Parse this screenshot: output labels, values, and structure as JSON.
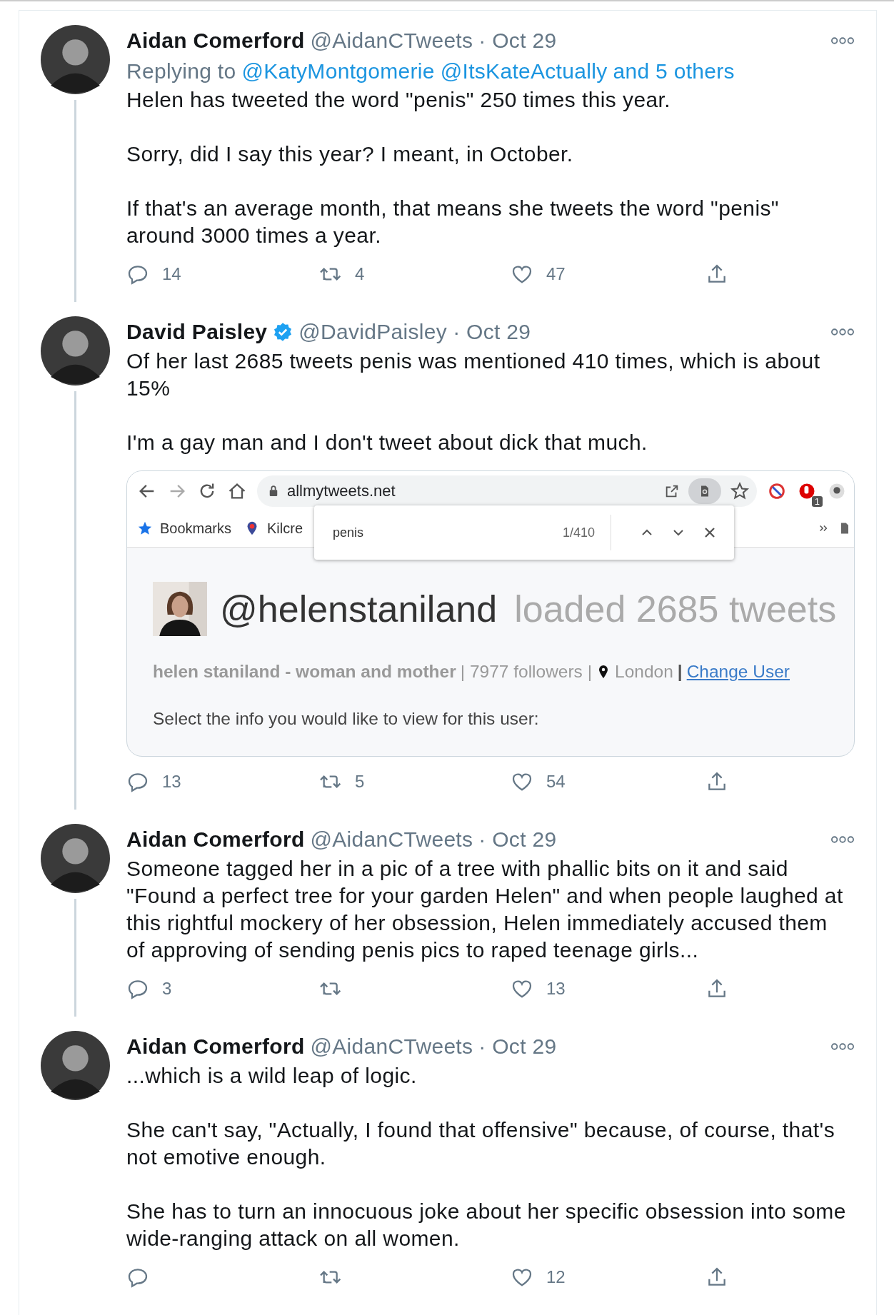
{
  "tweets": [
    {
      "name": "Aidan Comerford",
      "verified": false,
      "handle": "@AidanCTweets",
      "date": "· Oct 29",
      "connected": true,
      "replying_to": {
        "label": "Replying to",
        "mentions": [
          "@KatyMontgomerie",
          "@ItsKateActually",
          "and 5 others"
        ]
      },
      "paragraphs": [
        "Helen has tweeted the word \"penis\" 250 times this year.",
        "Sorry, did I say this year? I meant, in October.",
        "If that's an average month, that means she tweets the word \"penis\" around 3000 times a year."
      ],
      "replies": "14",
      "retweets": "4",
      "likes": "47"
    },
    {
      "name": "David Paisley",
      "verified": true,
      "handle": "@DavidPaisley",
      "date": "· Oct 29",
      "connected": true,
      "paragraphs": [
        "Of her last 2685 tweets penis was mentioned 410 times, which is about 15%",
        "I'm a gay man and I don't tweet about dick that much."
      ],
      "embed": {
        "url": "allmytweets.net",
        "bookmarks": [
          {
            "label": "Bookmarks",
            "kind": "star"
          },
          {
            "label": "Kilcre",
            "kind": "pin"
          }
        ],
        "extension_badge": "1",
        "find": {
          "query": "penis",
          "count": "1/410"
        },
        "profile": {
          "handle": "@helenstaniland",
          "loaded": "loaded 2685 tweets",
          "bio": "helen staniland - woman and mother",
          "followers": "| 7977 followers |",
          "location": "London",
          "separator": "|",
          "link": "Change User"
        },
        "prompt": "Select the info you would like to view for this user:"
      },
      "replies": "13",
      "retweets": "5",
      "likes": "54"
    },
    {
      "name": "Aidan Comerford",
      "verified": false,
      "handle": "@AidanCTweets",
      "date": "· Oct 29",
      "connected": true,
      "paragraphs": [
        "Someone tagged her in a pic of a tree with phallic bits on it and said \"Found a perfect tree for your garden Helen\" and when people laughed at this rightful mockery of her obsession, Helen immediately accused them of approving of sending penis pics to raped teenage girls..."
      ],
      "replies": "3",
      "likes": "13"
    },
    {
      "name": "Aidan Comerford",
      "verified": false,
      "handle": "@AidanCTweets",
      "date": "· Oct 29",
      "connected": false,
      "paragraphs": [
        "...which is a wild leap of logic.",
        "She can't say, \"Actually, I found that offensive\" because, of course, that's not emotive enough.",
        "She has to turn an innocuous joke about her specific obsession into some wide-ranging attack on all women."
      ],
      "likes": "12"
    }
  ]
}
